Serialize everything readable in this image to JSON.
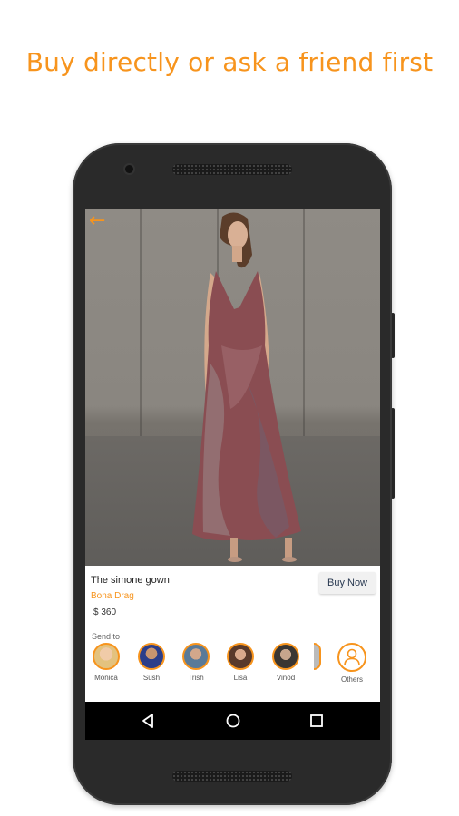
{
  "headline": "Buy directly or ask a friend first",
  "product": {
    "name": "The simone gown",
    "brand": "Bona Drag",
    "price": "$ 360",
    "buy_label": "Buy Now"
  },
  "send_to": {
    "label": "Send to",
    "contacts": [
      {
        "name": "Monica"
      },
      {
        "name": "Sush"
      },
      {
        "name": "Trish"
      },
      {
        "name": "Lisa"
      },
      {
        "name": "Vinod"
      }
    ],
    "others_label": "Others"
  },
  "colors": {
    "accent": "#f7941d",
    "buy_text": "#2a3a52"
  },
  "icons": {
    "back": "back-arrow-icon",
    "nav_back": "triangle-back-icon",
    "nav_home": "circle-home-icon",
    "nav_recents": "square-recents-icon",
    "others": "person-outline-icon"
  }
}
